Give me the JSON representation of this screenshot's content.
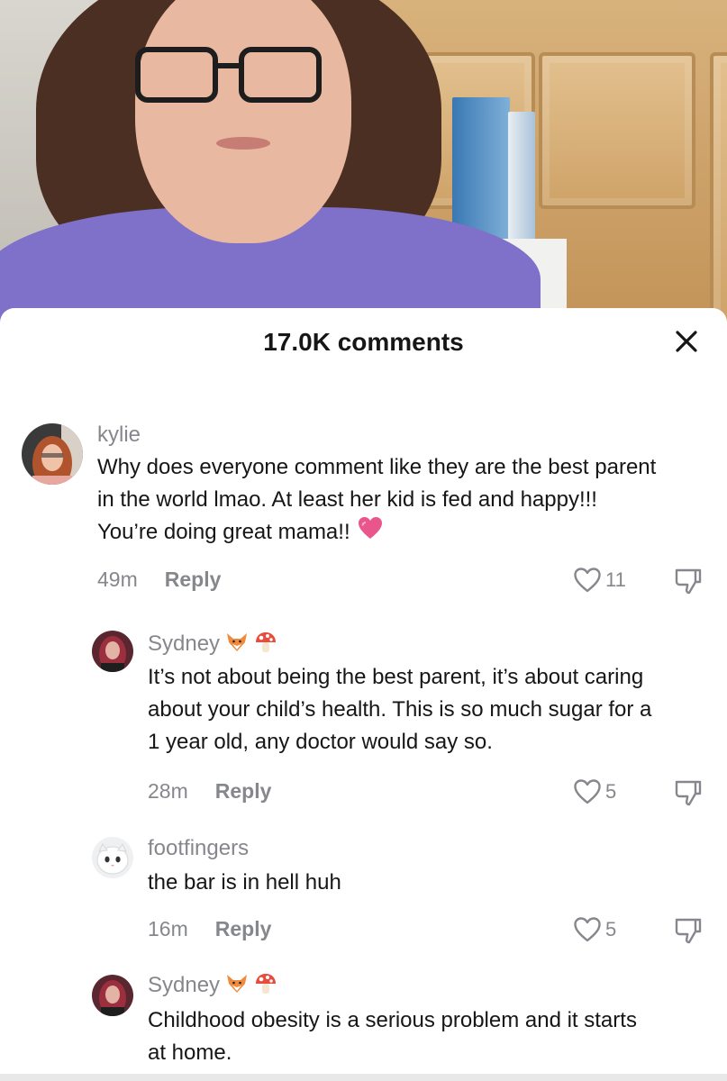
{
  "sheet": {
    "title": "17.0K comments",
    "close_glyph": "✕"
  },
  "comments": [
    {
      "username": "kylie",
      "text_lines": [
        "Why does everyone comment like they are the best parent",
        "in the world lmao. At least her kid is fed and happy!!!",
        "You’re doing great mama!!"
      ],
      "emoji": "heart-emoji",
      "time": "49m",
      "reply_label": "Reply",
      "likes": "11"
    },
    {
      "username": "Sydney",
      "user_emojis": [
        "fox-emoji",
        "mushroom-emoji"
      ],
      "text_lines": [
        "It’s not about being the best parent, it’s about caring",
        "about your child’s health. This is so much sugar for a",
        "1 year old, any doctor would say so."
      ],
      "time": "28m",
      "reply_label": "Reply",
      "likes": "5"
    },
    {
      "username": "footfingers",
      "text_lines": [
        "the bar is in hell huh"
      ],
      "time": "16m",
      "reply_label": "Reply",
      "likes": "5"
    },
    {
      "username": "Sydney",
      "user_emojis": [
        "fox-emoji",
        "mushroom-emoji"
      ],
      "text_lines": [
        "Childhood obesity is a serious problem and it starts",
        "at home."
      ]
    }
  ],
  "colors": {
    "sheet_bg": "#ffffff",
    "text": "#161616",
    "muted": "#86878c",
    "heart_pink": "#e8568b",
    "shirt": "#7f71c9"
  }
}
